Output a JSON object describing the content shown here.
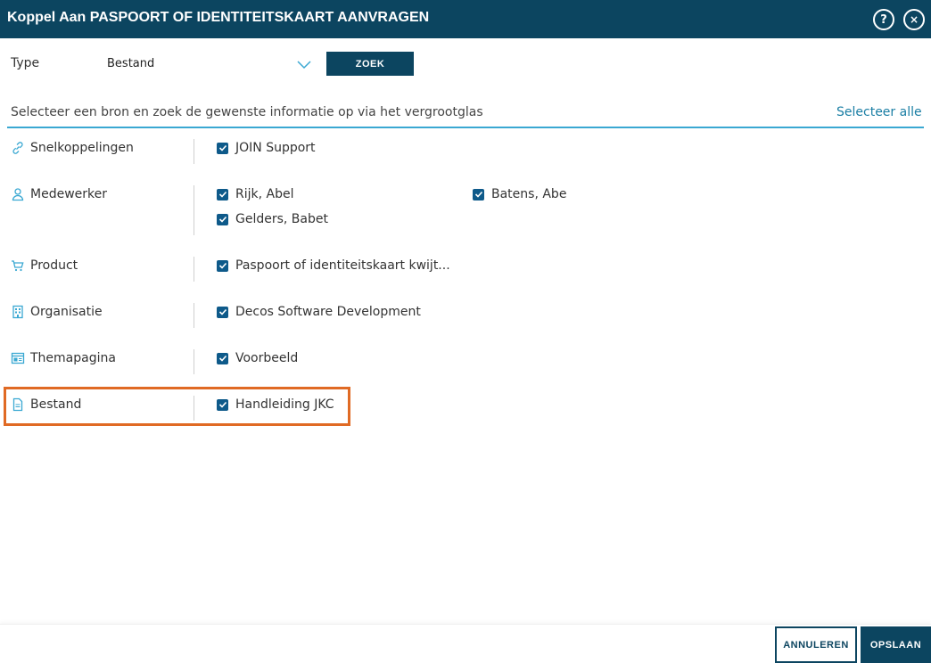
{
  "dialog": {
    "title": "Koppel Aan PASPOORT OF IDENTITEITSKAART AANVRAGEN",
    "help_glyph": "?",
    "close_glyph": "×"
  },
  "search": {
    "type_label": "Type",
    "type_value": "Bestand",
    "search_button": "ZOEK"
  },
  "hint": "Selecteer een bron en zoek de gewenste informatie op via het vergrootglas",
  "select_all": "Selecteer alle",
  "categories": [
    {
      "label": "Snelkoppelingen",
      "icon": "link-icon",
      "items": [
        {
          "label": "JOIN Support",
          "checked": true
        }
      ]
    },
    {
      "label": "Medewerker",
      "icon": "person-icon",
      "items": [
        {
          "label": "Rijk, Abel",
          "checked": true
        },
        {
          "label": "Batens, Abe",
          "checked": true
        },
        {
          "label": "Gelders, Babet",
          "checked": true
        }
      ]
    },
    {
      "label": "Product",
      "icon": "cart-icon",
      "items": [
        {
          "label": "Paspoort of identiteitskaart kwijt...",
          "checked": true
        }
      ]
    },
    {
      "label": "Organisatie",
      "icon": "building-icon",
      "items": [
        {
          "label": "Decos Software Development",
          "checked": true
        }
      ]
    },
    {
      "label": "Themapagina",
      "icon": "webpage-icon",
      "items": [
        {
          "label": "Voorbeeld",
          "checked": true
        }
      ]
    },
    {
      "label": "Bestand",
      "icon": "document-icon",
      "items": [
        {
          "label": "Handleiding JKC",
          "checked": true
        }
      ]
    }
  ],
  "footer": {
    "cancel": "ANNULEREN",
    "save": "OPSLAAN"
  },
  "colors": {
    "header": "#0c4560",
    "accent": "#3aa8d2",
    "checkbox": "#0e5a8a",
    "highlight": "#e06a24",
    "link": "#1a7ea4"
  }
}
